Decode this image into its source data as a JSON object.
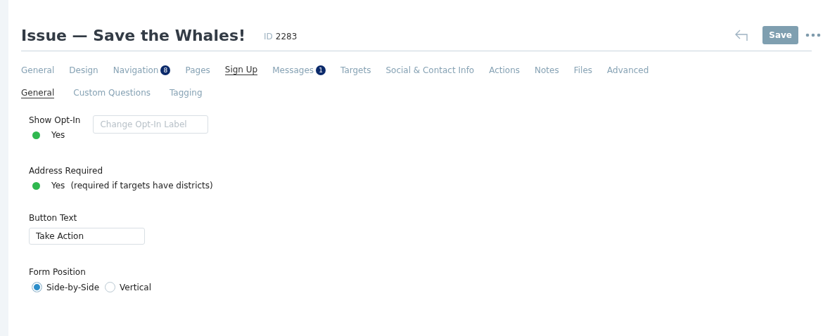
{
  "header": {
    "title": "Issue — Save the Whales!",
    "id_label": "ID",
    "id_value": "2283",
    "save_button": "Save"
  },
  "tabs": [
    {
      "label": "General",
      "selected": false
    },
    {
      "label": "Design",
      "selected": false
    },
    {
      "label": "Navigation",
      "badge": "8",
      "selected": false
    },
    {
      "label": "Pages",
      "selected": false
    },
    {
      "label": "Sign Up",
      "selected": true
    },
    {
      "label": "Messages",
      "badge": "1",
      "selected": false
    },
    {
      "label": "Targets",
      "selected": false
    },
    {
      "label": "Social & Contact Info",
      "selected": false
    },
    {
      "label": "Actions",
      "selected": false
    },
    {
      "label": "Notes",
      "selected": false
    },
    {
      "label": "Files",
      "selected": false
    },
    {
      "label": "Advanced",
      "selected": false
    }
  ],
  "subtabs": [
    {
      "label": "General",
      "selected": true
    },
    {
      "label": "Custom Questions",
      "selected": false
    },
    {
      "label": "Tagging",
      "selected": false
    }
  ],
  "form": [
    {
      "kind": "toggle",
      "label": "Show Opt-In",
      "on": true,
      "value": "Yes",
      "field_placeholder": "Change Opt-In Label"
    },
    {
      "kind": "toggle",
      "label": "Address Required",
      "on": true,
      "value": "Yes",
      "note": "(required if targets have districts)"
    },
    {
      "kind": "text",
      "label": "Button Text",
      "value": "Take Action"
    },
    {
      "kind": "radio",
      "label": "Form Position",
      "options": [
        {
          "label": "Side-by-Side",
          "selected": true
        },
        {
          "label": "Vertical",
          "selected": false
        }
      ]
    }
  ]
}
